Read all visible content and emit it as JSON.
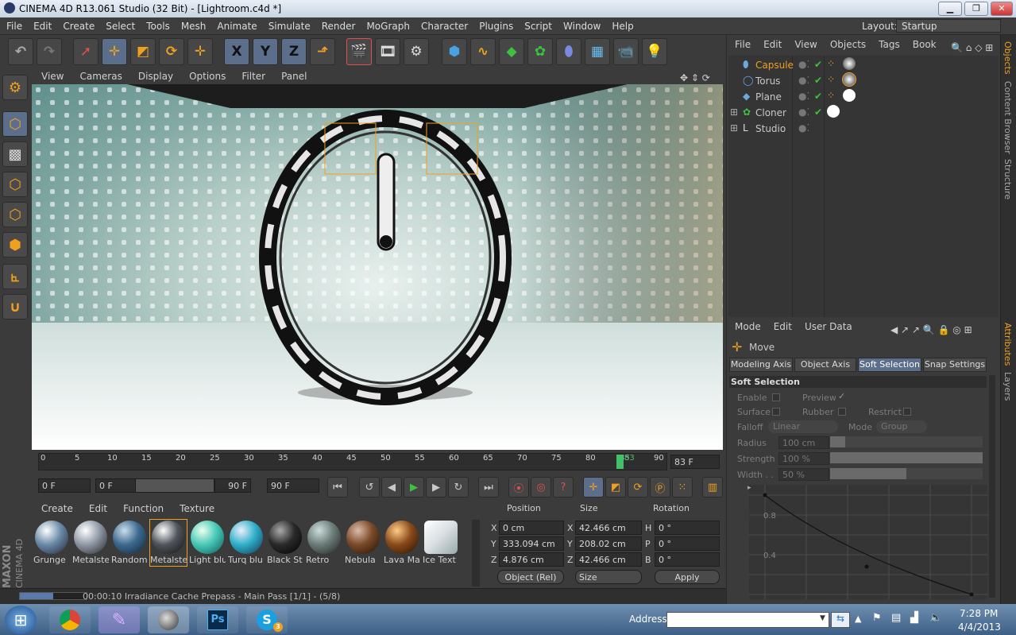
{
  "window": {
    "title": "CINEMA 4D R13.061 Studio (32 Bit) - [Lightroom.c4d *]",
    "minimize": "▁",
    "restore": "❐",
    "close": "✕"
  },
  "menubar": {
    "items": [
      "File",
      "Edit",
      "Create",
      "Select",
      "Tools",
      "Mesh",
      "Animate",
      "Simulate",
      "Render",
      "MoGraph",
      "Character",
      "Plugins",
      "Script",
      "Window",
      "Help"
    ],
    "layout_label": "Layout:",
    "layout_value": "Startup"
  },
  "toolbar": {
    "axis_x": "X",
    "axis_y": "Y",
    "axis_z": "Z"
  },
  "viewport": {
    "menu": [
      "View",
      "Cameras",
      "Display",
      "Options",
      "Filter",
      "Panel"
    ]
  },
  "timeline": {
    "ticks": [
      "0",
      "5",
      "10",
      "15",
      "20",
      "25",
      "30",
      "35",
      "40",
      "45",
      "50",
      "55",
      "60",
      "65",
      "70",
      "75",
      "80",
      "85",
      "90"
    ],
    "current_frame_marker": "83",
    "current_frame": "83 F",
    "start_field": "0 F",
    "range_start": "0 F",
    "range_end": "90 F",
    "end_field": "90 F"
  },
  "materials": {
    "menu": [
      "Create",
      "Edit",
      "Function",
      "Texture"
    ],
    "items": [
      {
        "label": "Grunge",
        "color": "#6a8aa8"
      },
      {
        "label": "Metalste",
        "color": "#8f98a6"
      },
      {
        "label": "Random",
        "color": "#3c6a8e"
      },
      {
        "label": "Metalste",
        "color": "#50555c"
      },
      {
        "label": "Light blu",
        "color": "#47c9b8"
      },
      {
        "label": "Turq blu",
        "color": "#2fb0c8"
      },
      {
        "label": "Black St",
        "color": "#2a2a2a"
      },
      {
        "label": "Retro",
        "color": "#6b7c78"
      },
      {
        "label": "Nebula",
        "color": "#7a4a2a"
      },
      {
        "label": "Lava Ma",
        "color": "#8a4a1a"
      },
      {
        "label": "Ice Text",
        "color": "#d8dee2"
      }
    ]
  },
  "coordinates": {
    "headers": {
      "position": "Position",
      "size": "Size",
      "rotation": "Rotation"
    },
    "pos": {
      "x": "0 cm",
      "y": "333.094 cm",
      "z": "4.876 cm"
    },
    "size": {
      "x": "42.466 cm",
      "y": "208.02 cm",
      "z": "42.466 cm"
    },
    "rot": {
      "h": "0 °",
      "p": "0 °",
      "b": "0 °"
    },
    "axis_labels": {
      "x": "X",
      "y": "Y",
      "z": "Z",
      "h": "H",
      "p": "P",
      "b": "B"
    },
    "mode": "Object (Rel)",
    "size_mode": "Size",
    "apply": "Apply"
  },
  "status": {
    "text": "00:00:10 Irradiance Cache Prepass - Main Pass [1/1] - (5/8)",
    "progress": 0.5
  },
  "maxon": {
    "brand": "MAXON",
    "product": "CINEMA 4D"
  },
  "objects": {
    "menu": [
      "File",
      "Edit",
      "View",
      "Objects",
      "Tags",
      "Book"
    ],
    "rows": [
      {
        "name": "Capsule",
        "highlight": true
      },
      {
        "name": "Torus",
        "highlight": false
      },
      {
        "name": "Plane",
        "highlight": false
      },
      {
        "name": "Cloner",
        "highlight": false
      },
      {
        "name": "Studio",
        "highlight": false
      }
    ]
  },
  "attributes": {
    "menu": [
      "Mode",
      "Edit",
      "User Data"
    ],
    "tool_name": "Move",
    "tabs": [
      "Modeling Axis",
      "Object Axis",
      "Soft Selection",
      "Snap Settings"
    ],
    "active_tab": "Soft Selection",
    "section": "Soft Selection",
    "enable": "Enable",
    "preview": "Preview",
    "surface": "Surface",
    "rubber": "Rubber",
    "restrict": "Restrict",
    "falloff": "Falloff",
    "falloff_value": "Linear",
    "mode": "Mode",
    "mode_value": "Group",
    "radius": "Radius",
    "radius_value": "100 cm",
    "strength": "Strength",
    "strength_value": "100 %",
    "width": "Width . .",
    "width_value": "50 %",
    "graph_labels": [
      "0.8",
      "0.4"
    ]
  },
  "side_tabs": {
    "objects": "Objects",
    "content_browser": "Content Browser",
    "structure": "Structure",
    "attributes": "Attributes",
    "layers": "Layers"
  },
  "taskbar": {
    "start": "⊞",
    "address_label": "Address",
    "time": "7:28 PM",
    "date": "4/4/2013",
    "skype_badge": "3"
  }
}
